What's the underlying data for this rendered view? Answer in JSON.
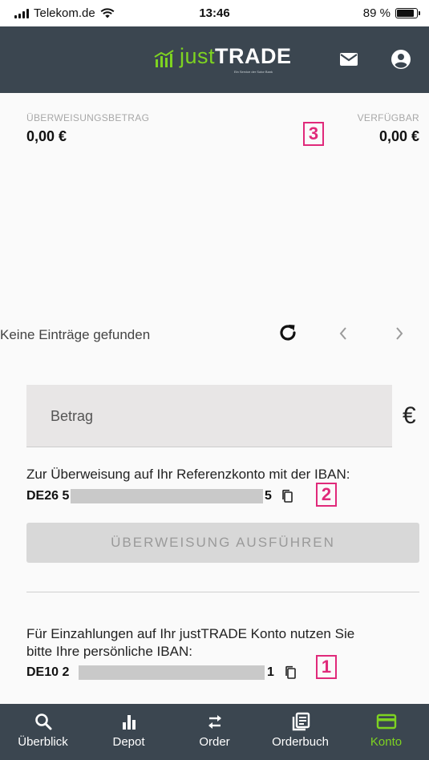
{
  "status_bar": {
    "carrier": "Telekom.de",
    "time": "13:46",
    "battery": "89 %"
  },
  "header": {
    "logo_prefix": "just",
    "logo_suffix": "TRADE",
    "logo_tagline": "Ein Service der Sutor Bank",
    "mail_icon": "mail-icon",
    "profile_icon": "account-circle-icon"
  },
  "transfer": {
    "amount_label": "ÜBERWEISUNGSBETRAG",
    "amount_value": "0,00 €",
    "available_label": "VERFÜGBAR",
    "available_value": "0,00 €",
    "marker_3": "3"
  },
  "list": {
    "empty_text": "Keine Einträge gefunden",
    "refresh_icon": "refresh-icon",
    "prev_icon": "chevron-left-icon",
    "next_icon": "chevron-right-icon"
  },
  "form": {
    "amount_placeholder": "Betrag",
    "currency_symbol": "€",
    "reference_info": "Zur Überweisung auf Ihr Referenzkonto mit der IBAN:",
    "reference_iban_start": "DE26 5",
    "reference_iban_end": "5",
    "marker_2": "2",
    "execute_label": "ÜBERWEISUNG AUSFÜHREN"
  },
  "deposit": {
    "info_line1": "Für Einzahlungen auf Ihr justTRADE Konto nutzen Sie",
    "info_line2": "bitte Ihre persönliche IBAN:",
    "iban_start": "DE10 2",
    "iban_end": "1",
    "marker_1": "1"
  },
  "nav": {
    "items": [
      {
        "label": "Überblick",
        "icon": "search-icon"
      },
      {
        "label": "Depot",
        "icon": "bar-chart-icon"
      },
      {
        "label": "Order",
        "icon": "swap-arrows-icon"
      },
      {
        "label": "Orderbuch",
        "icon": "book-icon"
      },
      {
        "label": "Konto",
        "icon": "credit-card-icon"
      }
    ],
    "active_color": "#7ed321"
  },
  "colors": {
    "header_bg": "#3b4650",
    "accent": "#7ed321",
    "marker": "#e0297a"
  }
}
